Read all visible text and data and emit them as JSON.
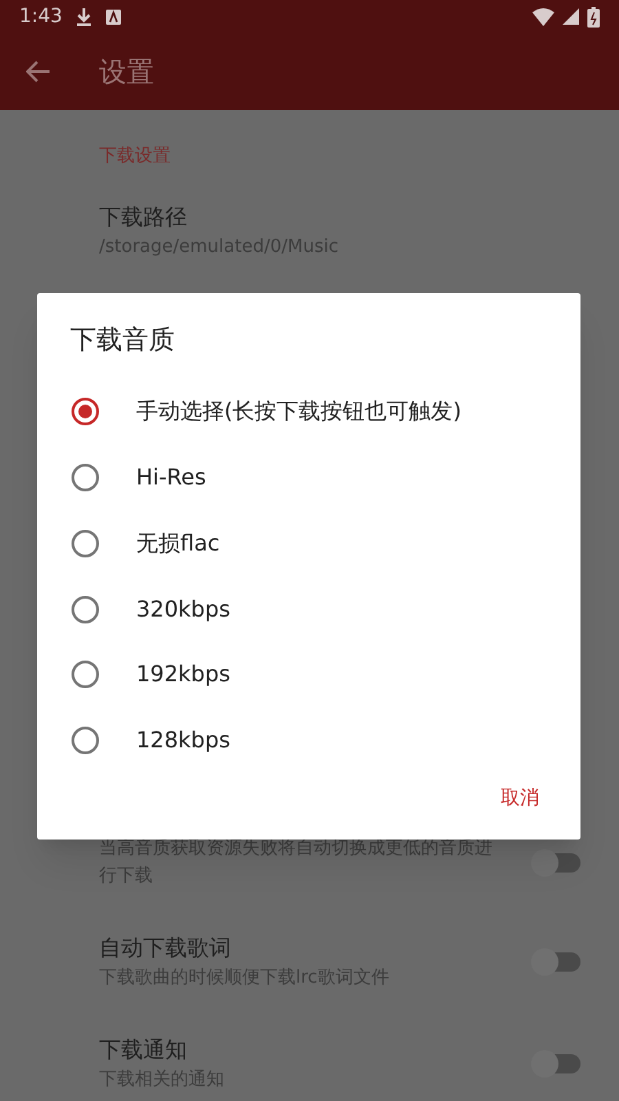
{
  "status_bar": {
    "time": "1:43"
  },
  "toolbar": {
    "title": "设置"
  },
  "section": {
    "title": "下载设置"
  },
  "path_item": {
    "title": "下载路径",
    "summary": "/storage/emulated/0/Music"
  },
  "toggle_items": [
    {
      "summary": "当高音质获取资源失败将自动切换成更低的音质进行下载",
      "on": false
    },
    {
      "title": "自动下载歌词",
      "summary": "下载歌曲的时候顺便下载lrc歌词文件",
      "on": false
    },
    {
      "title": "下载通知",
      "summary": "下载相关的通知",
      "on": false
    }
  ],
  "dialog": {
    "title": "下载音质",
    "options": [
      {
        "label": "手动选择(长按下载按钮也可触发)",
        "selected": true
      },
      {
        "label": "Hi-Res",
        "selected": false
      },
      {
        "label": "无损flac",
        "selected": false
      },
      {
        "label": "320kbps",
        "selected": false
      },
      {
        "label": "192kbps",
        "selected": false
      },
      {
        "label": "128kbps",
        "selected": false
      }
    ],
    "cancel": "取消"
  }
}
